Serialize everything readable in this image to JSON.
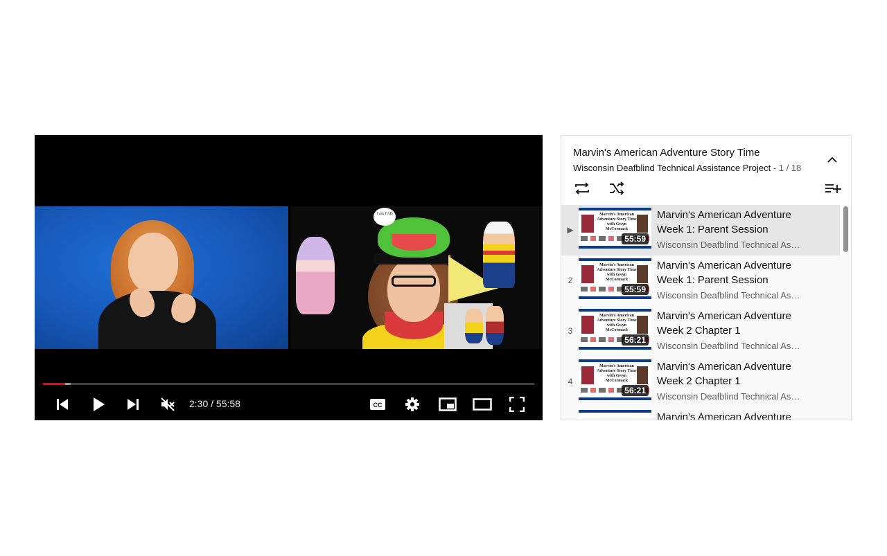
{
  "player": {
    "current_time": "2:30",
    "separator": " / ",
    "duration": "55:58",
    "progress_fraction": 0.045,
    "buffer_fraction": 0.057,
    "badge_text": "I am FAB"
  },
  "playlist": {
    "title": "Marvin's American Adventure Story Time",
    "channel": "Wisconsin Deafblind Technical Assistance Project",
    "position": "- 1 / 18",
    "active_marker": "▶",
    "thumb_caption": "Marvin's American Adventure Story Time with Gwyn McCormack",
    "items": [
      {
        "index": "▶",
        "title_line1": "Marvin's American Adventure",
        "title_line2": "Week 1: Parent Session",
        "channel": "Wisconsin Deafblind Technical Ass...",
        "duration": "55:59"
      },
      {
        "index": "2",
        "title_line1": "Marvin's American Adventure",
        "title_line2": "Week 1: Parent Session",
        "channel": "Wisconsin Deafblind Technical Ass...",
        "duration": "55:59"
      },
      {
        "index": "3",
        "title_line1": "Marvin's American Adventure",
        "title_line2": "Week 2 Chapter 1",
        "channel": "Wisconsin Deafblind Technical Ass...",
        "duration": "56:21"
      },
      {
        "index": "4",
        "title_line1": "Marvin's American Adventure",
        "title_line2": "Week 2 Chapter 1",
        "channel": "Wisconsin Deafblind Technical Ass...",
        "duration": "56:21"
      },
      {
        "index": "",
        "title_line1": "Marvin's American Adventure",
        "title_line2": "",
        "channel": "",
        "duration": ""
      }
    ]
  },
  "colors": {
    "progress": "#ff0000",
    "active_row": "#e6e6e6"
  }
}
